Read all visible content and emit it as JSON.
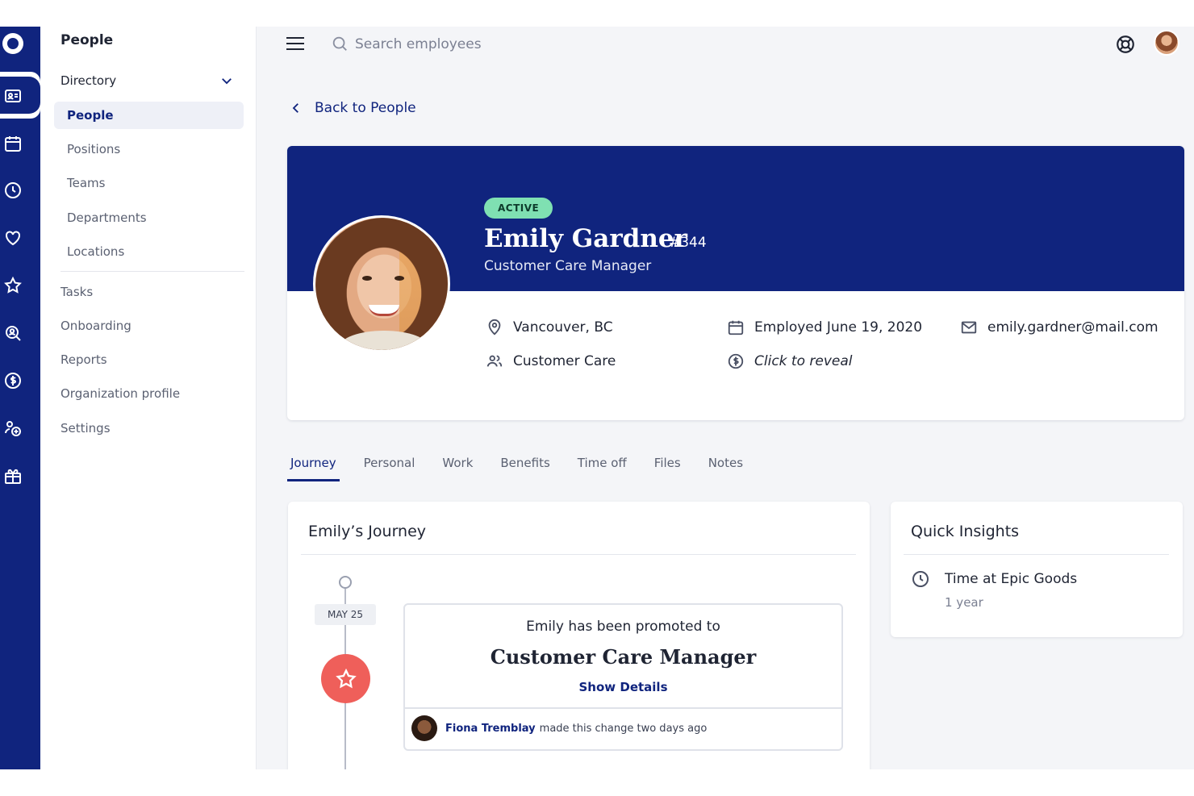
{
  "sidebar": {
    "title": "People",
    "group_label": "Directory",
    "sub_items": [
      {
        "label": "People",
        "active": true
      },
      {
        "label": "Positions"
      },
      {
        "label": "Teams"
      },
      {
        "label": "Departments"
      },
      {
        "label": "Locations"
      }
    ],
    "top_items": [
      {
        "label": "Tasks"
      },
      {
        "label": "Onboarding"
      },
      {
        "label": "Reports"
      },
      {
        "label": "Organization profile"
      },
      {
        "label": "Settings"
      }
    ],
    "rail_icons": [
      "app-logo-icon",
      "people-card-icon",
      "calendar-icon",
      "clock-icon",
      "heart-icon",
      "star-icon",
      "search-person-icon",
      "dollar-icon",
      "user-add-icon",
      "gift-icon"
    ]
  },
  "topbar": {
    "search_placeholder": "Search employees",
    "help_icon": "lifebuoy-icon"
  },
  "back": {
    "label": "Back to People"
  },
  "profile": {
    "status": "ACTIVE",
    "name": "Emily Gardner",
    "id": "#344",
    "role": "Customer Care Manager",
    "location": "Vancouver, BC",
    "department": "Customer Care",
    "employed": "Employed June 19, 2020",
    "salary": "Click to reveal",
    "email": "emily.gardner@mail.com",
    "banner_color": "#10247e",
    "status_color": "#7fe0b2"
  },
  "tabs": [
    {
      "label": "Journey",
      "active": true
    },
    {
      "label": "Personal"
    },
    {
      "label": "Work"
    },
    {
      "label": "Benefits"
    },
    {
      "label": "Time off"
    },
    {
      "label": "Files"
    },
    {
      "label": "Notes"
    }
  ],
  "journey": {
    "title": "Emily’s Journey",
    "event": {
      "date": "MAY 25",
      "lead": "Emily has been promoted to",
      "role": "Customer Care Manager",
      "link": "Show Details",
      "changed_by": "Fiona Tremblay",
      "change_note": "made this change two days ago",
      "icon_color": "#ef5f5a"
    }
  },
  "insights": {
    "title": "Quick Insights",
    "items": [
      {
        "label": "Time at Epic Goods",
        "value": "1 year"
      }
    ]
  }
}
